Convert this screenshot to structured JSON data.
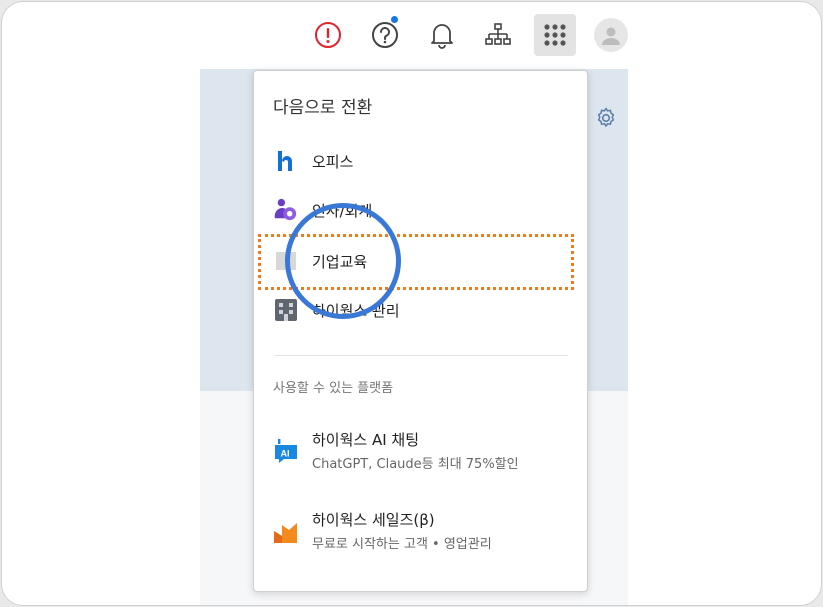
{
  "topbar": {
    "icons": [
      "alert-icon",
      "help-icon",
      "bell-icon",
      "org-chart-icon",
      "apps-grid-icon",
      "avatar-icon"
    ],
    "alert_color": "#e0242b"
  },
  "dropdown": {
    "title": "다음으로 전환",
    "items": [
      {
        "label": "오피스",
        "icon": "hiworks-office-icon"
      },
      {
        "label": "인사/회계",
        "icon": "hr-accounting-icon"
      },
      {
        "label": "기업교육",
        "icon": "corporate-education-icon"
      },
      {
        "label": "하이웍스 관리",
        "icon": "hiworks-admin-icon"
      }
    ],
    "section_label": "사용할 수 있는 플랫폼",
    "platforms": [
      {
        "name": "하이웍스 AI 채팅",
        "desc": "ChatGPT, Claude등 최대 75%할인",
        "icon": "ai-chat-icon"
      },
      {
        "name": "하이웍스 세일즈(β)",
        "desc": "무료로 시작하는 고객 • 영업관리",
        "icon": "sales-icon"
      }
    ]
  },
  "colors": {
    "highlight_box": "#f07a1c",
    "highlight_circle": "#3a78d8",
    "brand_blue": "#1a73e8"
  }
}
